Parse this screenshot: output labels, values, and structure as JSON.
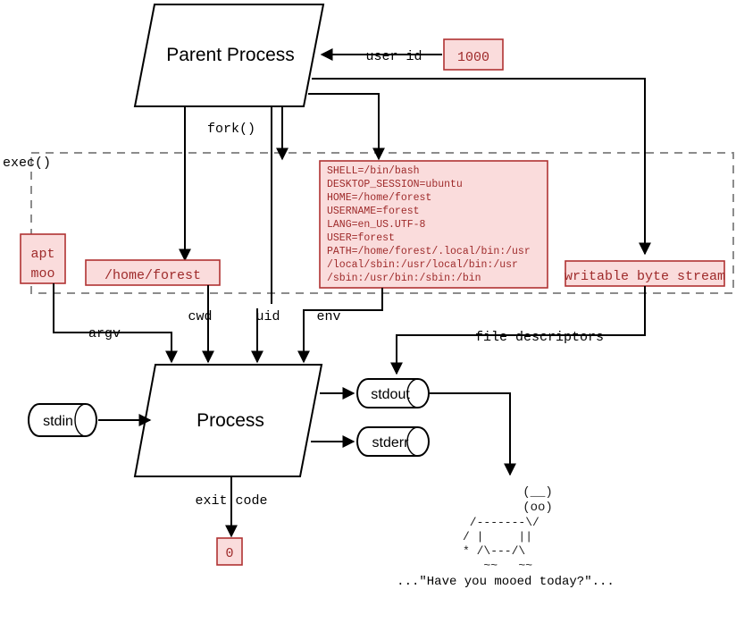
{
  "diagram": {
    "title": "Unix process model: fork, exec, and process attributes",
    "colors": {
      "accent_red": "#9e2a2a",
      "box_fill": "#fadcdc",
      "box_border": "#b03232",
      "line": "#000000",
      "dashed_boundary": "#8c8c8c"
    },
    "nodes": {
      "parent_process": {
        "label": "Parent Process",
        "shape": "parallelogram"
      },
      "process": {
        "label": "Process",
        "shape": "parallelogram"
      },
      "user_id_value": {
        "label": "1000",
        "shape": "box",
        "style": "pink"
      },
      "cwd_value": {
        "label": "/home/forest",
        "shape": "box",
        "style": "pink"
      },
      "argv_value": {
        "line1": "apt",
        "line2": "moo",
        "shape": "box",
        "style": "pink"
      },
      "fd_value": {
        "label": "writable byte stream",
        "shape": "box",
        "style": "pink"
      },
      "exit_code_value": {
        "label": "0",
        "shape": "box",
        "style": "pink"
      },
      "stdin": {
        "label": "stdin",
        "shape": "cylinder"
      },
      "stdout": {
        "label": "stdout",
        "shape": "cylinder"
      },
      "stderr": {
        "label": "stderr",
        "shape": "cylinder"
      }
    },
    "edge_labels": {
      "user_id": "user id",
      "fork": "fork()",
      "exec": "exec()",
      "argv": "argv",
      "cwd": "cwd",
      "uid": "uid",
      "env": "env",
      "file_descriptors": "file descriptors",
      "exit_code": "exit code"
    },
    "environment_box": {
      "lines": [
        "SHELL=/bin/bash",
        "DESKTOP_SESSION=ubuntu",
        "HOME=/home/forest",
        "USERNAME=forest",
        "LANG=en_US.UTF-8",
        "USER=forest",
        "PATH=/home/forest/.local/bin:/usr",
        "/local/sbin:/usr/local/bin:/usr",
        "/sbin:/usr/bin:/sbin:/bin"
      ]
    },
    "cow_output": {
      "art_lines": [
        "        (__)",
        "        (oo)",
        " /-------\\/",
        "/ |     ||",
        "* /\\---/\\",
        "   ~~   ~~"
      ],
      "caption": "...\"Have you mooed today?\"..."
    }
  }
}
